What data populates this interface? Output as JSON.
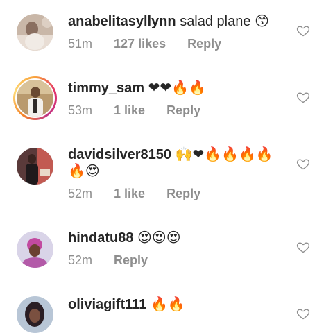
{
  "comments": [
    {
      "username": "anabelitasyllynn",
      "text": "salad plane",
      "emoji": "😙",
      "emoji2": "",
      "time": "51m",
      "likes": "127 likes",
      "reply": "Reply"
    },
    {
      "username": "timmy_sam",
      "text": "",
      "emoji": "❤❤🔥🔥",
      "emoji2": "",
      "time": "53m",
      "likes": "1 like",
      "reply": "Reply"
    },
    {
      "username": "davidsilver8150",
      "text": "",
      "emoji": "🙌❤🔥🔥🔥🔥",
      "emoji2": "🔥😍",
      "time": "52m",
      "likes": "1 like",
      "reply": "Reply"
    },
    {
      "username": "hindatu88",
      "text": "",
      "emoji": "😍😍😍",
      "emoji2": "",
      "time": "52m",
      "likes": "",
      "reply": "Reply"
    },
    {
      "username": "oliviagift111",
      "text": "",
      "emoji": "🔥🔥",
      "emoji2": "",
      "time": "",
      "likes": "",
      "reply": ""
    }
  ],
  "icons": {
    "like": "heart-outline-icon"
  },
  "colors": {
    "username": "#262626",
    "meta": "#8e8e8e",
    "heart_outline": "#8e8e8e"
  }
}
